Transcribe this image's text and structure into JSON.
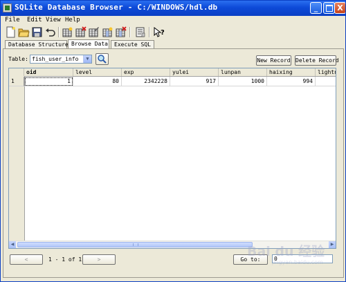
{
  "window": {
    "title": "SQLite Database Browser - C:/WINDOWS/hdl.db",
    "minimize_glyph": "_",
    "close_glyph": "X"
  },
  "menu": [
    "File",
    "Edit",
    "View",
    "Help"
  ],
  "toolbar": {
    "icons": [
      "new-database-icon",
      "open-database-icon",
      "save-icon",
      "undo-icon",
      "create-table-icon",
      "delete-table-icon",
      "modify-table-icon",
      "create-index-icon",
      "delete-index-icon",
      "query-icon",
      "whats-this-icon"
    ]
  },
  "tabs": [
    "Database Structure",
    "Browse Data",
    "Execute SQL"
  ],
  "active_tab": "Browse Data",
  "browse": {
    "table_label": "Table:",
    "table_value": "fish_user_info",
    "new_record": "New Record",
    "delete_record": "Delete Record",
    "columns": [
      "oid",
      "level",
      "exp",
      "yulei",
      "lunpan",
      "haixing",
      "lightni"
    ],
    "rows": [
      {
        "row_number": "1",
        "values": [
          "1",
          "80",
          "2342228",
          "917",
          "1000",
          "994",
          ""
        ]
      }
    ],
    "pager_prev": "<",
    "pager_text": "1 - 1 of 1",
    "pager_next": ">",
    "goto_label": "Go to:",
    "goto_value": "0"
  },
  "watermark": {
    "text": "Bai du 经验",
    "url": "jingyan.baidu.com"
  },
  "colors": {
    "titlebar": "#0a3fc4",
    "window_bg": "#ece9d8",
    "grid_border": "#7f9db9"
  }
}
